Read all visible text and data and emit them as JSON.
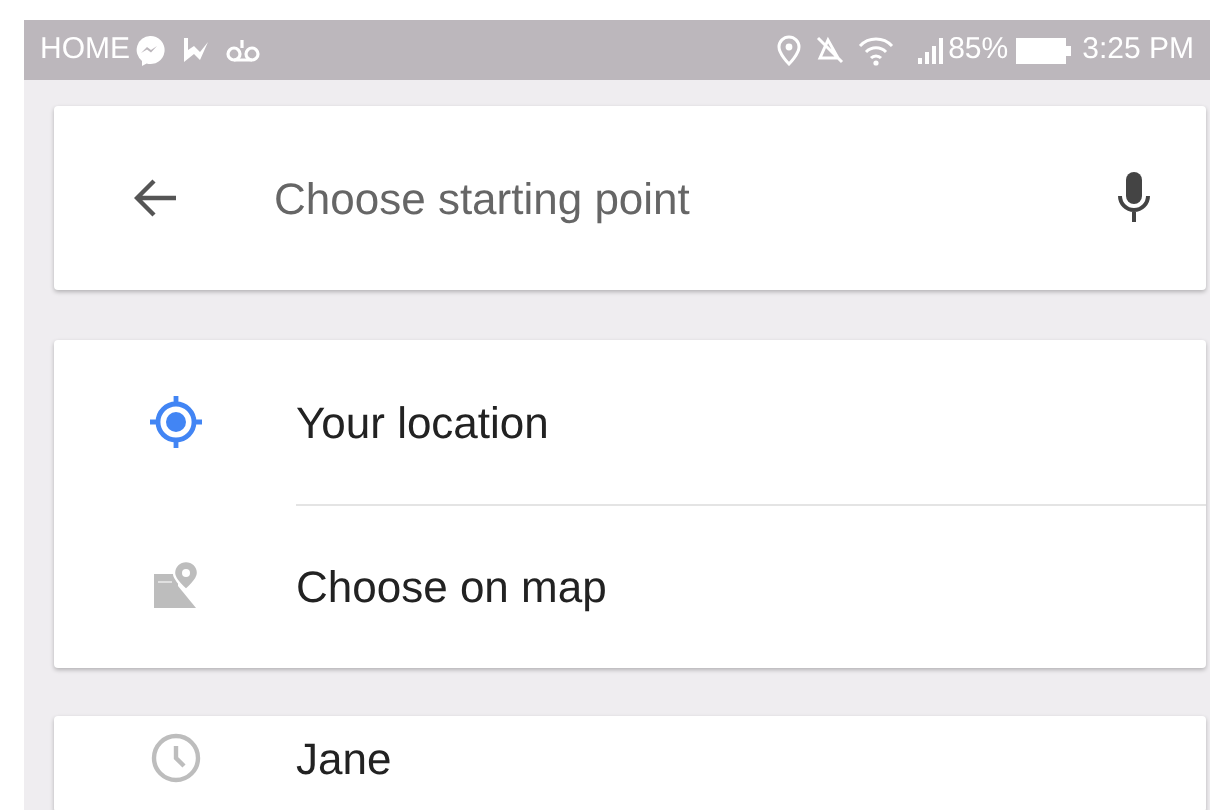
{
  "status_bar": {
    "carrier": "HOME",
    "battery": "85%",
    "time": "3:25 PM"
  },
  "search": {
    "placeholder": "Choose starting point"
  },
  "options": [
    {
      "kind": "location",
      "label": "Your location"
    },
    {
      "kind": "map",
      "label": "Choose on map"
    }
  ],
  "history": [
    {
      "kind": "recent",
      "label": "Jane"
    }
  ]
}
